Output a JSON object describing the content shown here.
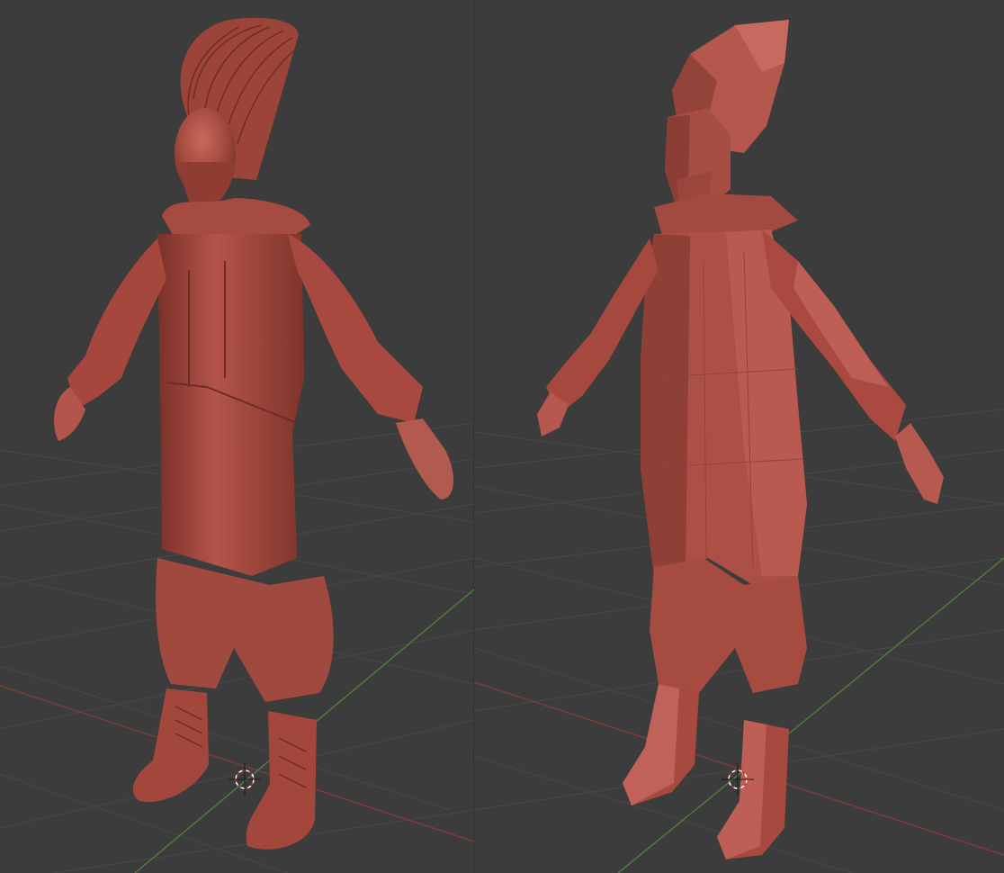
{
  "app": {
    "type": "3d-viewport-comparison"
  },
  "colors": {
    "background": "#3c3c3c",
    "grid_line": "#4a4a4a",
    "axis_x": "#8a3a3a",
    "axis_y": "#4e8a3a",
    "model_base": "#a14a3e",
    "model_light": "#c4645a",
    "model_shadow": "#6b2b25",
    "cursor_red": "#ffffff"
  },
  "viewports": [
    {
      "id": "left",
      "label": "",
      "model": "high-poly-sculpt",
      "shading": "smooth-matcap"
    },
    {
      "id": "right",
      "label": "",
      "model": "low-poly-retopo",
      "shading": "flat-matcap"
    }
  ],
  "icons": {
    "cursor": "3d-cursor-icon"
  }
}
